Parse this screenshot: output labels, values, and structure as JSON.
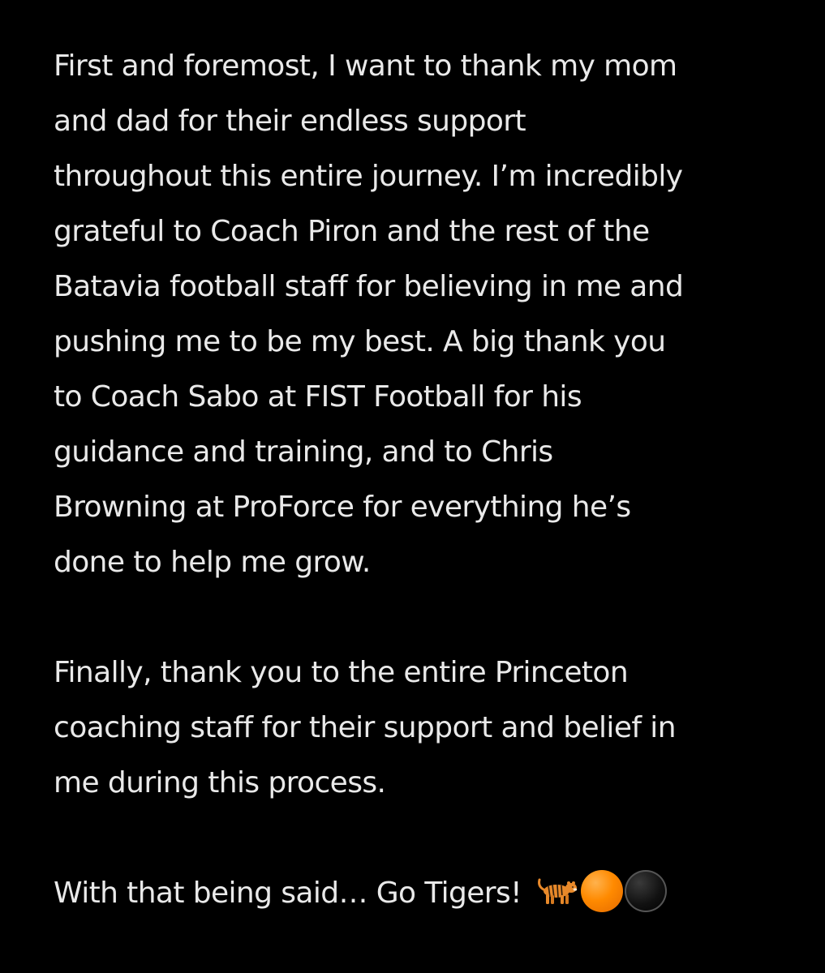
{
  "paragraphs": [
    {
      "lines": [
        "First and foremost, I want to thank my mom",
        "and dad for their endless support",
        "throughout this entire journey. I’m incredibly",
        "grateful to Coach Piron and the rest of the",
        "Batavia football staff for believing in me and",
        "pushing me to be my best. A big thank you",
        "to Coach Sabo at FIST Football for his",
        "guidance and training, and to Chris",
        "Browning at ProForce for everything he’s",
        "done to help me grow."
      ]
    },
    {
      "lines": [
        "Finally, thank you to the entire Princeton",
        "coaching staff for their support and belief in",
        "me during this process."
      ]
    },
    {
      "lines": [
        "With that being said… Go Tigers!"
      ]
    }
  ],
  "emojis": [
    "tiger-icon",
    "orange-circle-icon",
    "black-circle-icon"
  ],
  "colors": {
    "background": "#000000",
    "text": "#e9e9e9",
    "orange": "#ff8a00"
  }
}
